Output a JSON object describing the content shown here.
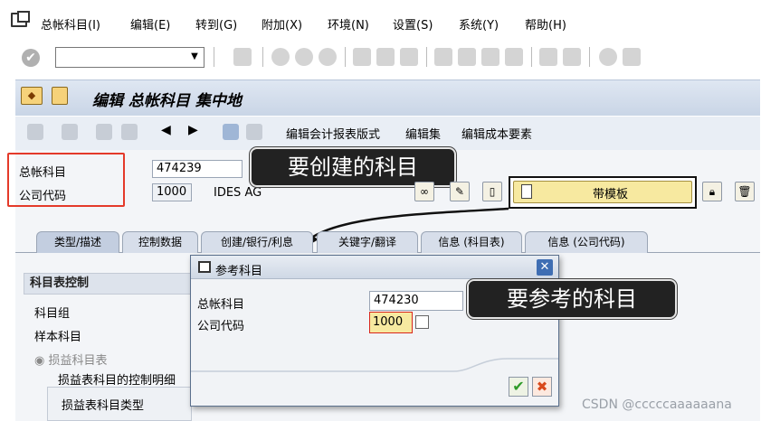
{
  "menu": {
    "items": [
      "总帐科目(I)",
      "编辑(E)",
      "转到(G)",
      "附加(X)",
      "环境(N)",
      "设置(S)",
      "系统(Y)",
      "帮助(H)"
    ]
  },
  "title": "编辑 总帐科目 集中地",
  "appbar": {
    "buttons": [
      "编辑会计报表版式",
      "编辑集",
      "编辑成本要素"
    ]
  },
  "header_fields": {
    "gl_account_label": "总帐科目",
    "gl_account_value": "474239",
    "company_code_label": "公司代码",
    "company_code_value": "1000",
    "company_name": "IDES AG"
  },
  "template_button_label": "带模板",
  "callouts": {
    "create": "要创建的科目",
    "reference": "要参考的科目"
  },
  "tabs": [
    "类型/描述",
    "控制数据",
    "创建/银行/利息",
    "关键字/翻译",
    "信息 (科目表)",
    "信息 (公司代码)"
  ],
  "content": {
    "section": "科目表控制",
    "row1": "科目组",
    "row2": "样本科目",
    "radio": "损益科目表",
    "group_hdr": "损益表科目的控制明细",
    "group_row": "损益表科目类型"
  },
  "dialog": {
    "title": "参考科目",
    "gl_account_label": "总帐科目",
    "gl_account_value": "474230",
    "company_code_label": "公司代码",
    "company_code_value": "1000"
  },
  "watermark": "CSDN @cccccaaaaaana"
}
